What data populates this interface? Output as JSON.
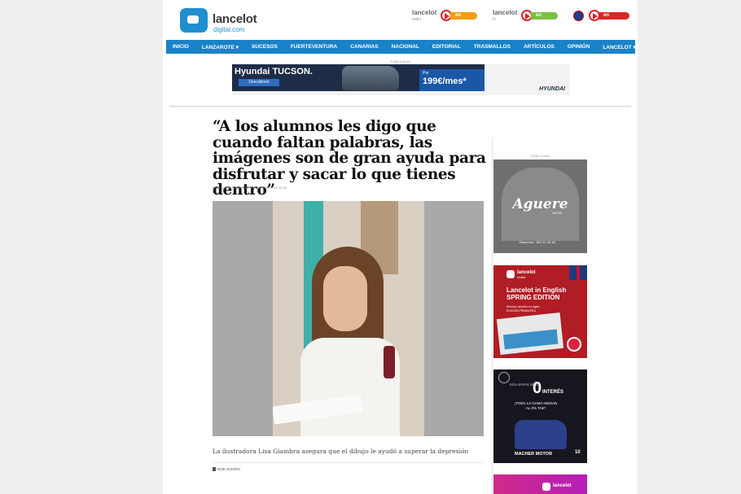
{
  "header": {
    "logo": {
      "word": "lancelot",
      "sub": "digital.com"
    },
    "live_streams": [
      {
        "brand": "lancelot",
        "sub": "radio",
        "badge": "en directo",
        "color": "#f39c12"
      },
      {
        "brand": "lancelot",
        "sub": "tv",
        "badge": "en directo",
        "color": "#7bc043"
      },
      {
        "brand": "",
        "sub": "",
        "badge": "en directo",
        "color": "#d9262a"
      }
    ]
  },
  "nav": {
    "items": [
      "INICIO",
      "LANZAROTE ▾",
      "SUCESOS",
      "FUERTEVENTURA",
      "CANARIAS",
      "NACIONAL",
      "EDITORIAL",
      "TRASMALLOS",
      "ARTÍCULOS",
      "OPINIÓN",
      "LANCELOT ▾"
    ]
  },
  "top_ad": {
    "label": "PUBLICIDAD",
    "title": "Hyundai TUCSON.",
    "button": "Descúbrelo",
    "price_prefix": "Por",
    "price": "199€/mes*",
    "brand": "HYUNDAI"
  },
  "article": {
    "title": "“A los alumnos les digo que cuando faltan palabras, las imágenes son de gran ayuda para disfrutar y sacar lo que tienes dentro”",
    "published": "PUBLICADO: VIERNES, 20 FEBRERO 2015 15:16",
    "caption": "La ilustradora Lisa Giambra asegura que el dibujo le ayudó a superar la depresión",
    "author": "NOE RAMÓN"
  },
  "sidebar": {
    "label": "PUBLICIDAD",
    "ad1": {
      "name": "Aguere",
      "sub": "HOTEL",
      "phone": "Reservas · 922 31 40 30"
    },
    "ad2": {
      "logo": "lancelot",
      "logo_sub": "revista",
      "headline_1": "Lancelot in English",
      "headline_2": "SPRING EDITION",
      "sub_1": "Revista Lancelot en inglés",
      "sub_2": "EDICIÓN PRIMAVERA"
    },
    "ad3": {
      "small": "ESTA OFERTA TIENE",
      "zero": "0",
      "interest": "INTERÉS",
      "gama_1": "¡TODA LA GAMA NISSAN",
      "gama_2": "AL 0% TAE*",
      "dealer": "MACHER MOTOR",
      "years": "10"
    },
    "ad4": {
      "logo": "lancelot"
    }
  }
}
